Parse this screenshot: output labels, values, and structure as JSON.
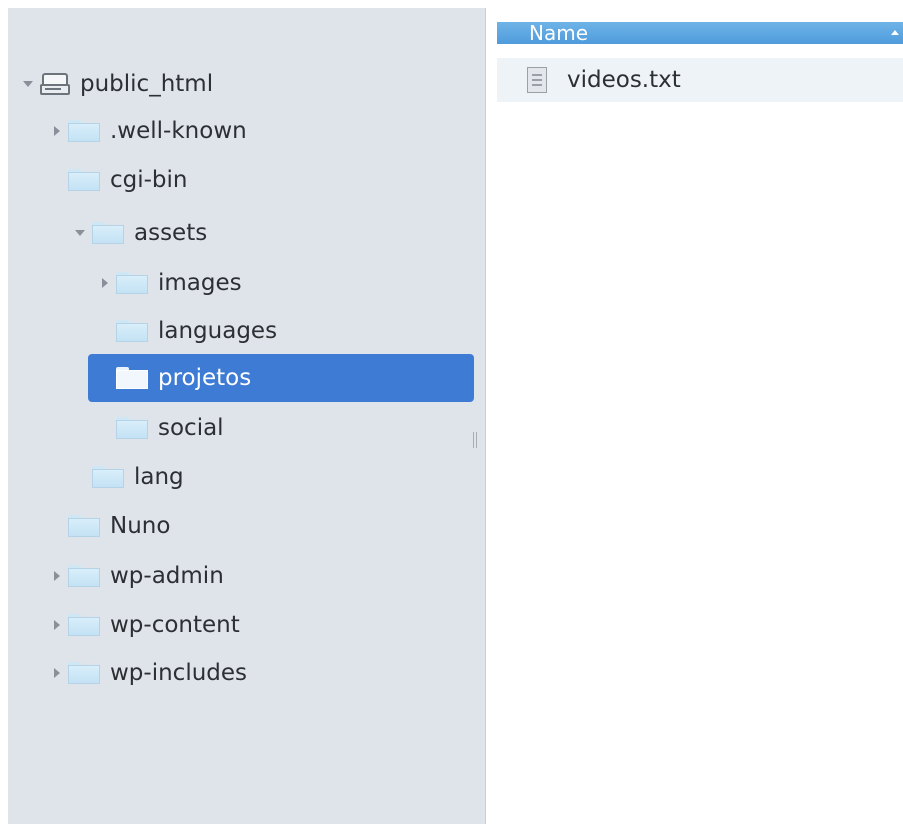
{
  "tree": {
    "root": {
      "label": "public_html",
      "icon": "drive-icon",
      "state": "expanded"
    },
    "items": [
      {
        "label": ".well-known",
        "state": "collapsed"
      },
      {
        "label": "cgi-bin",
        "state": "none"
      },
      {
        "label": "assets",
        "state": "expanded"
      },
      {
        "label": "images",
        "state": "collapsed"
      },
      {
        "label": "languages",
        "state": "none"
      },
      {
        "label": "projetos",
        "state": "none",
        "selected": true
      },
      {
        "label": "social",
        "state": "none"
      },
      {
        "label": "lang",
        "state": "none"
      },
      {
        "label": "Nuno",
        "state": "none"
      },
      {
        "label": "wp-admin",
        "state": "collapsed"
      },
      {
        "label": "wp-content",
        "state": "collapsed"
      },
      {
        "label": "wp-includes",
        "state": "collapsed"
      }
    ]
  },
  "list": {
    "column_header": "Name",
    "files": [
      {
        "name": "videos.txt",
        "icon": "text-file-icon"
      }
    ]
  },
  "colors": {
    "tree_background": "#dfe4ea",
    "selection": "#3d7bd4",
    "header": "#5aa5e0",
    "row_background": "#eef3f8"
  }
}
